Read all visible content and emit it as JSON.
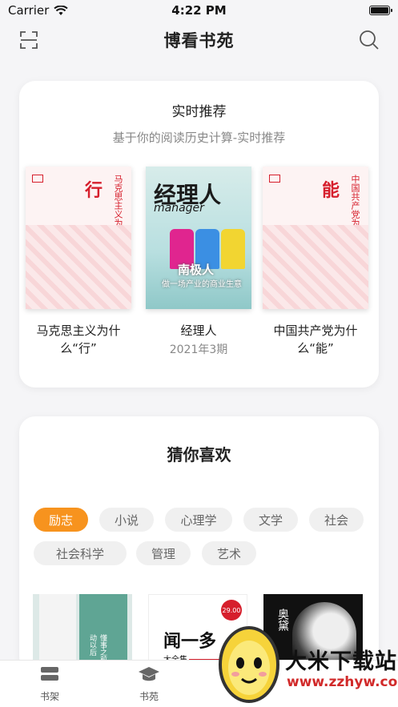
{
  "status": {
    "carrier": "Carrier",
    "time": "4:22 PM"
  },
  "nav": {
    "title": "博看书苑"
  },
  "recommend": {
    "title": "实时推荐",
    "subtitle": "基于你的阅读历史计算-实时推荐",
    "books": [
      {
        "title": "马克思主义为什么“行”",
        "cover_char": "行",
        "cover_vertical": "马克思主义为什么"
      },
      {
        "title": "经理人",
        "issue": "2021年3期",
        "cover_title": "经理人",
        "cover_sub": "manager",
        "cover_headline": "南极人",
        "cover_headline2": "做一场产业的商业生意"
      },
      {
        "title": "中国共产党为什么“能”",
        "cover_char": "能",
        "cover_vertical": "中国共产党为什么"
      }
    ]
  },
  "guess": {
    "title": "猜你喜欢",
    "tags": [
      "励志",
      "小说",
      "心理学",
      "文学",
      "社会",
      "社会科学",
      "管理",
      "艺术"
    ],
    "mini_books": [
      {
        "cover_text": "懂事之前 情动以后"
      },
      {
        "cover_text": "闻一多",
        "cover_sub": "大全集",
        "price_badge": "29.00"
      },
      {
        "cover_text": "奥黛"
      }
    ]
  },
  "tabs": [
    {
      "label": "书架",
      "icon": "bookshelf-icon"
    },
    {
      "label": "书苑",
      "icon": "graduation-cap-icon"
    }
  ],
  "watermark": {
    "text": "大米下载站",
    "url": "www.zzhyw.com"
  },
  "colors": {
    "accent": "#f7931e",
    "red": "#d61f2c"
  }
}
